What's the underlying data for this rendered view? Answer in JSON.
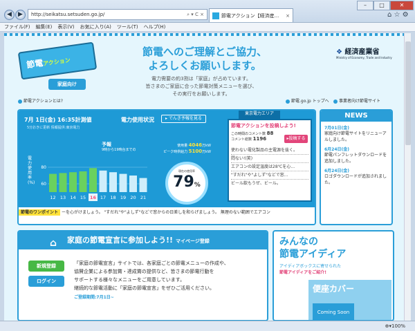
{
  "browser": {
    "url": "http://seikatsu.setsuden.go.jp/",
    "addr_controls": "⌕ ▾ C ×",
    "tab_title": "節電アクション【経済産...",
    "menu": [
      "ファイル(F)",
      "編集(E)",
      "表示(V)",
      "お気に入り(A)",
      "ツール(T)",
      "ヘルプ(H)"
    ],
    "zoom": "100%"
  },
  "header": {
    "logo_main": "節電",
    "logo_sub": "アクション",
    "home_btn": "家庭向け",
    "hero_title_1": "節電へのご理解とご協力、",
    "hero_title_2": "よろしくお願いします。",
    "hero_body_1": "電力需要の約3割は「家庭」が占めています。",
    "hero_body_2": "皆さまのご家庭に合った節電対策メニューを選び、",
    "hero_body_3": "その実行をお願いします。",
    "ministry": "経済産業省",
    "ministry_en": "Ministry of Economy, Trade and Industry",
    "link_about": "節電アクションとは?",
    "link_top": "節電.go.jp トップへ",
    "link_biz": "事業者向け節電サイト"
  },
  "status": {
    "date": "7月 1日(金) 16:35計測値",
    "update_note": "5分おきに更新 情報提供:東京電力",
    "title": "電力使用状況",
    "forecast_btn": "でんき予報を見る",
    "area_tab": "東京電力エリア",
    "forecast_label": "予報",
    "forecast_sub": "9時から19時台までの",
    "usage_label": "使用量",
    "usage_value": "4046",
    "usage_unit": "万kW",
    "peak_label": "ピーク時供給力",
    "peak_value": "5100",
    "peak_unit": "万kW",
    "gauge_label": "現在の使用率",
    "gauge_value": "79",
    "gauge_unit": "%",
    "y_label": "電力使用率(%)",
    "ticker_tag": "節電のワンポイント",
    "ticker": "ーを心がけましょう。 \"すだれ\"や\"よしず\"などで窓からの日差しを和らげましょう。 無理のない範囲でエアコン"
  },
  "chart_data": {
    "type": "bar",
    "categories": [
      "12",
      "13",
      "14",
      "15",
      "16",
      "17",
      "18",
      "19",
      "20",
      "21"
    ],
    "highlight": "16",
    "values": [
      72,
      73,
      74,
      75,
      79,
      76,
      74,
      72,
      70,
      67
    ],
    "yticks": [
      "60",
      "80"
    ],
    "ylim": [
      50,
      100
    ],
    "colors": {
      "past": "#6ad15e",
      "future": "#cfeefb",
      "current": "#ff4f7b"
    }
  },
  "post": {
    "title": "節電アクションを投稿しよう!",
    "today_label": "この時間のコメント数",
    "today_value": "88",
    "total_label": "コメント総数",
    "total_value": "1196",
    "button": "投稿する",
    "comments": [
      "使わない電化製品の主電源を抜く。",
      "悶ない!(笑)",
      "エアコンの設定温度は28℃を心...",
      "\"すだれ\"や\"よしず\"などで窓...",
      "ビール飲もうぜ、ビール。"
    ]
  },
  "news": {
    "title": "NEWS",
    "items": [
      {
        "date": "7月01日(金)",
        "text": "家庭向け節電サイトをリニューアルしました。"
      },
      {
        "date": "6月24日(金)",
        "text": "節電パンフレットダウンロードを追加しました。"
      },
      {
        "date": "6月24日(金)",
        "text": "ロゴダウンロードが追加されました。"
      }
    ]
  },
  "declaration": {
    "title": "家庭の節電宣言に参加しよう!!",
    "mypage": "マイページ登録",
    "register": "新規登録",
    "login": "ログイン",
    "body_1": "「家庭の節電宣言」サイトでは、各家庭ごとの節電メニューの作成や、",
    "body_2": "協賛企業による参加賞・達成賞の提供など、皆さまの節電行動を",
    "body_3": "サポートする様々なメニューをご用意しています。",
    "body_4": "継続的な節電活動に「家庭の節電宣言」をぜひご活用ください。",
    "period": "ご登録期間:7月1日~"
  },
  "idea": {
    "title_1": "みんなの",
    "title_2": "節電アイディア",
    "sub_1": "アイディアボックスに寄せられた",
    "sub_2": "節電アイディアをご紹介!",
    "coming": "Coming Soon",
    "bg_text": "便座カバー"
  }
}
